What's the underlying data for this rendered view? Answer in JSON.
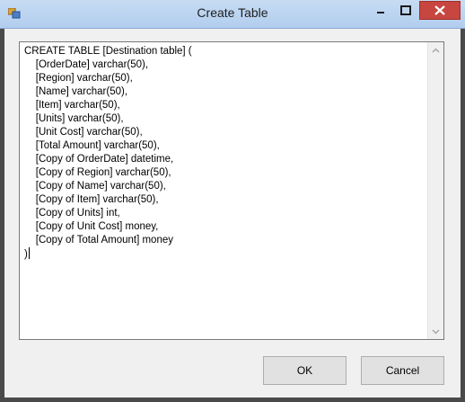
{
  "window": {
    "title": "Create Table",
    "icon": "app-form-icon",
    "controls": [
      "minimize-icon",
      "maximize-icon",
      "close-icon"
    ]
  },
  "sql": {
    "lines": [
      "CREATE TABLE [Destination table] (",
      "    [OrderDate] varchar(50),",
      "    [Region] varchar(50),",
      "    [Name] varchar(50),",
      "    [Item] varchar(50),",
      "    [Units] varchar(50),",
      "    [Unit Cost] varchar(50),",
      "    [Total Amount] varchar(50),",
      "    [Copy of OrderDate] datetime,",
      "    [Copy of Region] varchar(50),",
      "    [Copy of Name] varchar(50),",
      "    [Copy of Item] varchar(50),",
      "    [Copy of Units] int,",
      "    [Copy of Unit Cost] money,",
      "    [Copy of Total Amount] money",
      ")"
    ]
  },
  "buttons": {
    "ok_label": "OK",
    "cancel_label": "Cancel"
  },
  "colors": {
    "titlebar": "#b9d3f0",
    "close_button": "#c7463f",
    "dialog_bg": "#f0f0f0"
  }
}
